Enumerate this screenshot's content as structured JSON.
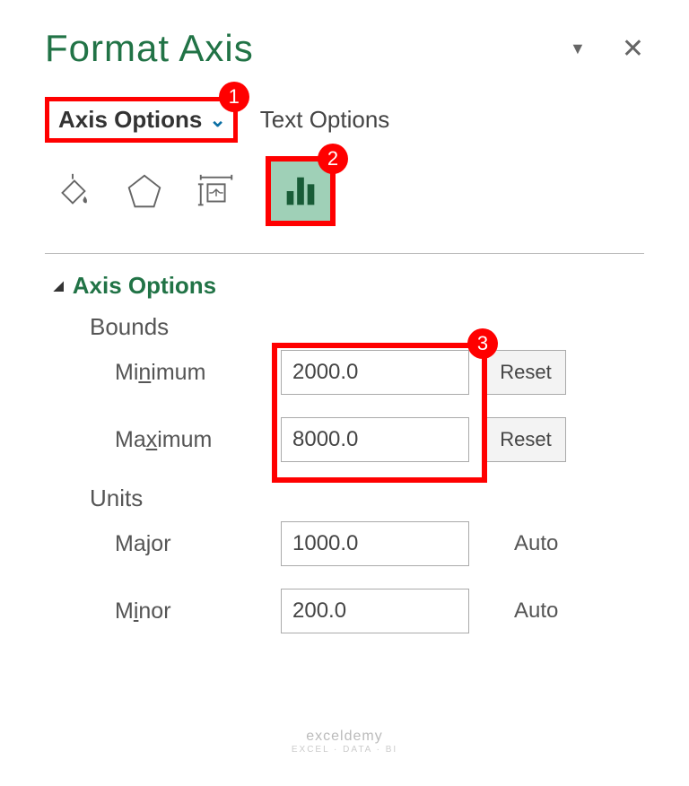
{
  "header": {
    "title": "Format Axis",
    "axis_options_tab": "Axis Options",
    "text_options_tab": "Text Options"
  },
  "badges": {
    "one": "1",
    "two": "2",
    "three": "3"
  },
  "icons": {
    "fill": "paint-bucket-icon",
    "effects": "pentagon-icon",
    "size": "size-props-icon",
    "axis": "axis-options-icon"
  },
  "section": {
    "axis_options": "Axis Options",
    "bounds": "Bounds",
    "units": "Units"
  },
  "fields": {
    "min_label_pre": "Mi",
    "min_label_u": "n",
    "min_label_post": "imum",
    "max_label_pre": "Ma",
    "max_label_u": "x",
    "max_label_post": "imum",
    "major_label_pre": "Ma",
    "major_label_u": "j",
    "major_label_post": "or",
    "minor_label_pre": "M",
    "minor_label_u": "i",
    "minor_label_post": "nor",
    "min_value": "2000.0",
    "max_value": "8000.0",
    "major_value": "1000.0",
    "minor_value": "200.0",
    "reset": "Reset",
    "auto": "Auto"
  },
  "watermark": {
    "main": "exceldemy",
    "sub": "EXCEL · DATA · BI"
  }
}
